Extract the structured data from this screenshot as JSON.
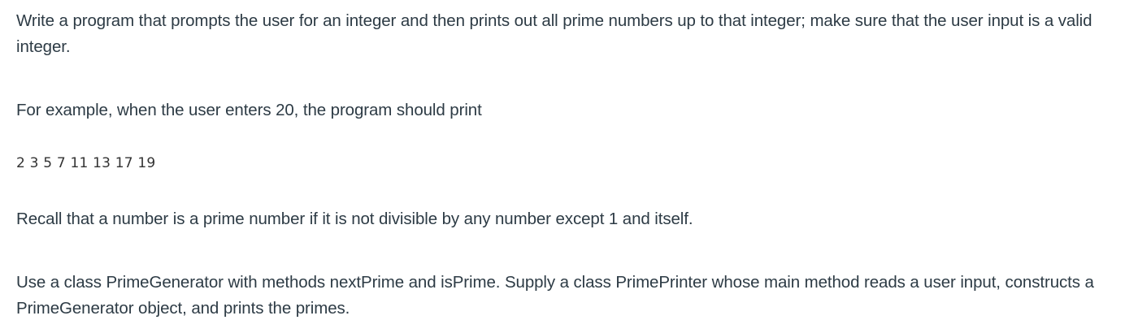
{
  "question": {
    "intro": "Write a program that prompts the user for an integer and then prints out all prime numbers up to that integer; make sure that the user input is a valid integer.",
    "example_lead": "For example, when the user enters 20, the program should print",
    "example_output": "2 3 5 7 11 13 17 19",
    "recall": "Recall that a number is a prime number if it is not divisible by any number except 1 and itself.",
    "task": "Use a class PrimeGenerator with methods nextPrime and isPrime. Supply a class PrimePrinter whose main method reads a user input, constructs a PrimeGenerator object, and prints the primes."
  }
}
